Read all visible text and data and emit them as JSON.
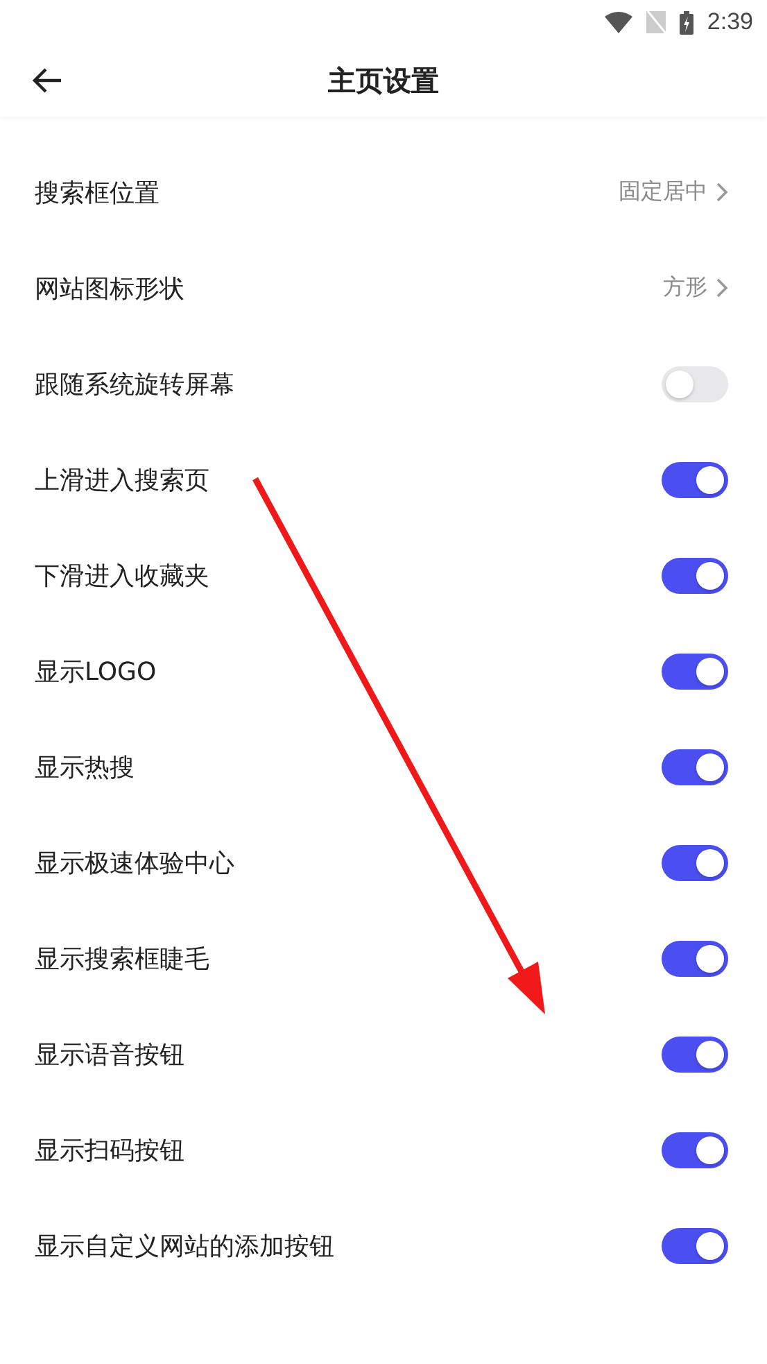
{
  "status_bar": {
    "time": "2:39"
  },
  "header": {
    "title": "主页设置"
  },
  "settings": [
    {
      "kind": "choice",
      "label": "搜索框位置",
      "value": "固定居中"
    },
    {
      "kind": "choice",
      "label": "网站图标形状",
      "value": "方形"
    },
    {
      "kind": "toggle",
      "label": "跟随系统旋转屏幕",
      "on": false
    },
    {
      "kind": "toggle",
      "label": "上滑进入搜索页",
      "on": true
    },
    {
      "kind": "toggle",
      "label": "下滑进入收藏夹",
      "on": true
    },
    {
      "kind": "toggle",
      "label": "显示LOGO",
      "on": true
    },
    {
      "kind": "toggle",
      "label": "显示热搜",
      "on": true
    },
    {
      "kind": "toggle",
      "label": "显示极速体验中心",
      "on": true
    },
    {
      "kind": "toggle",
      "label": "显示搜索框睫毛",
      "on": true
    },
    {
      "kind": "toggle",
      "label": "显示语音按钮",
      "on": true
    },
    {
      "kind": "toggle",
      "label": "显示扫码按钮",
      "on": true
    },
    {
      "kind": "toggle",
      "label": "显示自定义网站的添加按钮",
      "on": true
    }
  ],
  "annotation_arrow": true
}
